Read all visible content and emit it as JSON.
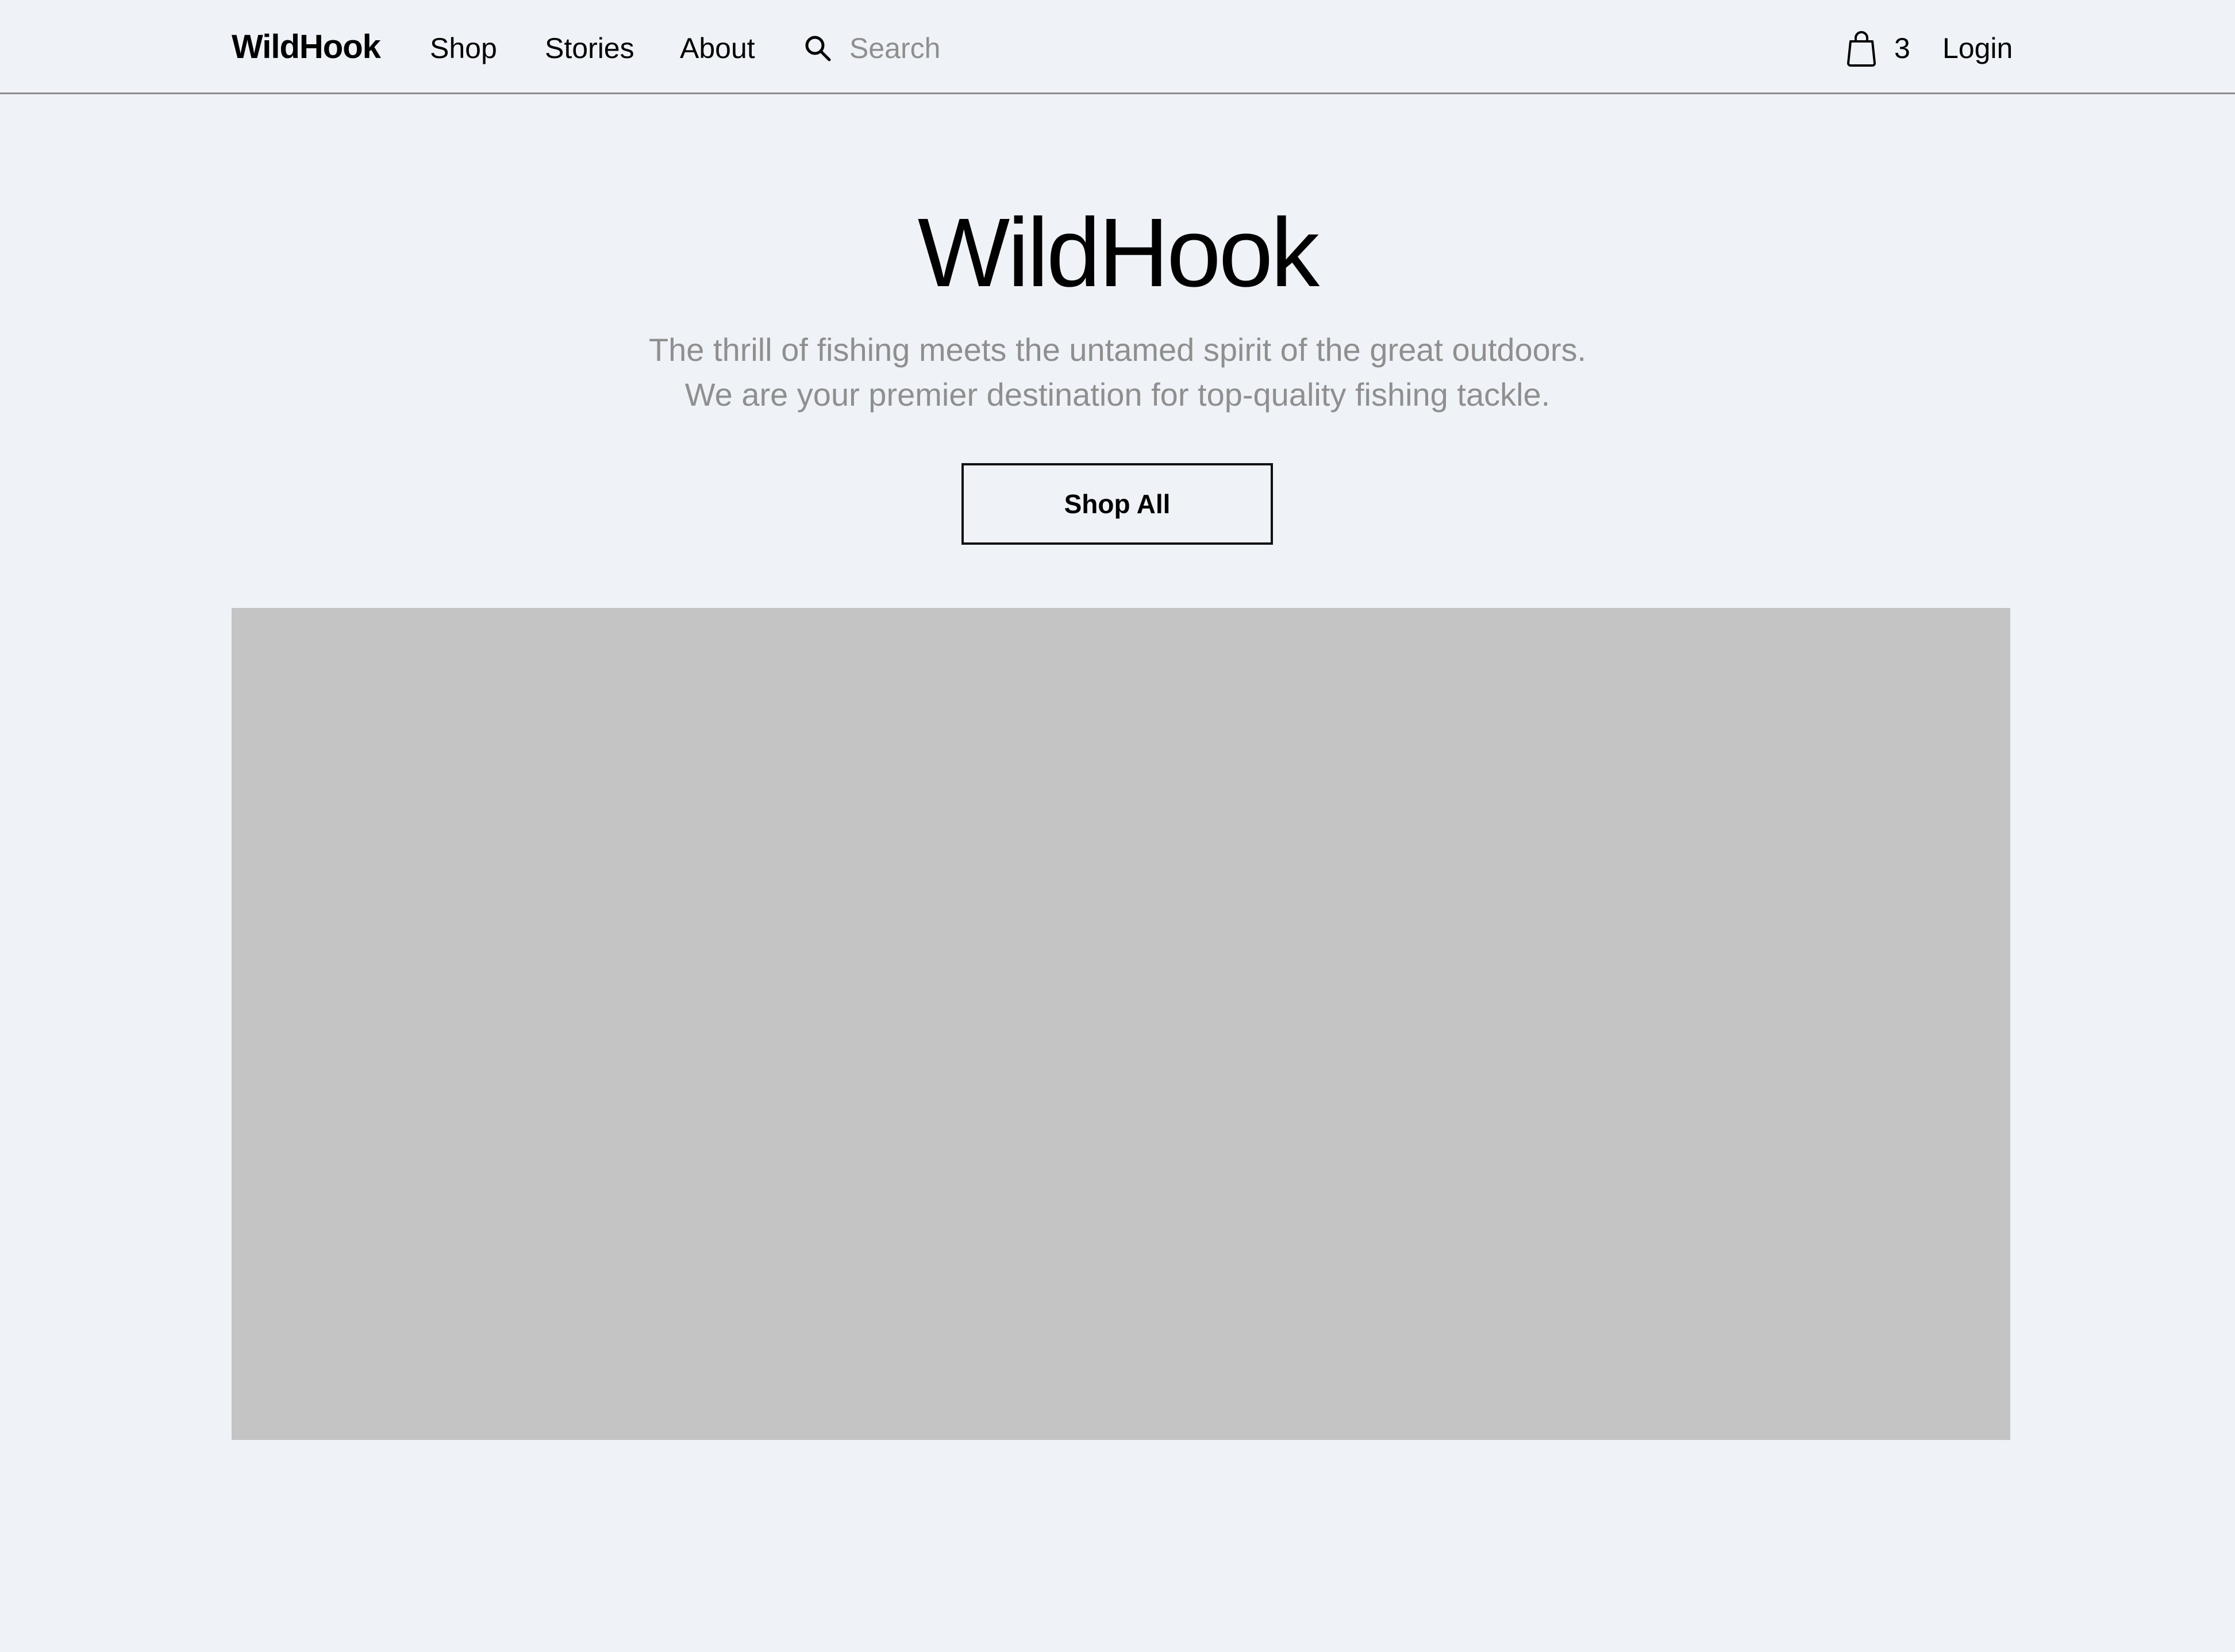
{
  "header": {
    "logo": "WildHook",
    "nav": {
      "shop": "Shop",
      "stories": "Stories",
      "about": "About"
    },
    "search": {
      "placeholder": "Search",
      "value": ""
    },
    "cart": {
      "count": "3"
    },
    "login": "Login"
  },
  "hero": {
    "title": "WildHook",
    "subtitle_line1": "The thrill of fishing meets the untamed spirit of the great outdoors.",
    "subtitle_line2": "We are your premier destination for top-quality fishing tackle.",
    "cta": "Shop All"
  },
  "colors": {
    "background": "#eff2f6",
    "image_placeholder": "#c4c4c4",
    "muted_text": "#8f8f8f",
    "divider": "#8a8a8a"
  },
  "icons": {
    "search": "search-icon",
    "cart": "shopping-bag-icon"
  }
}
